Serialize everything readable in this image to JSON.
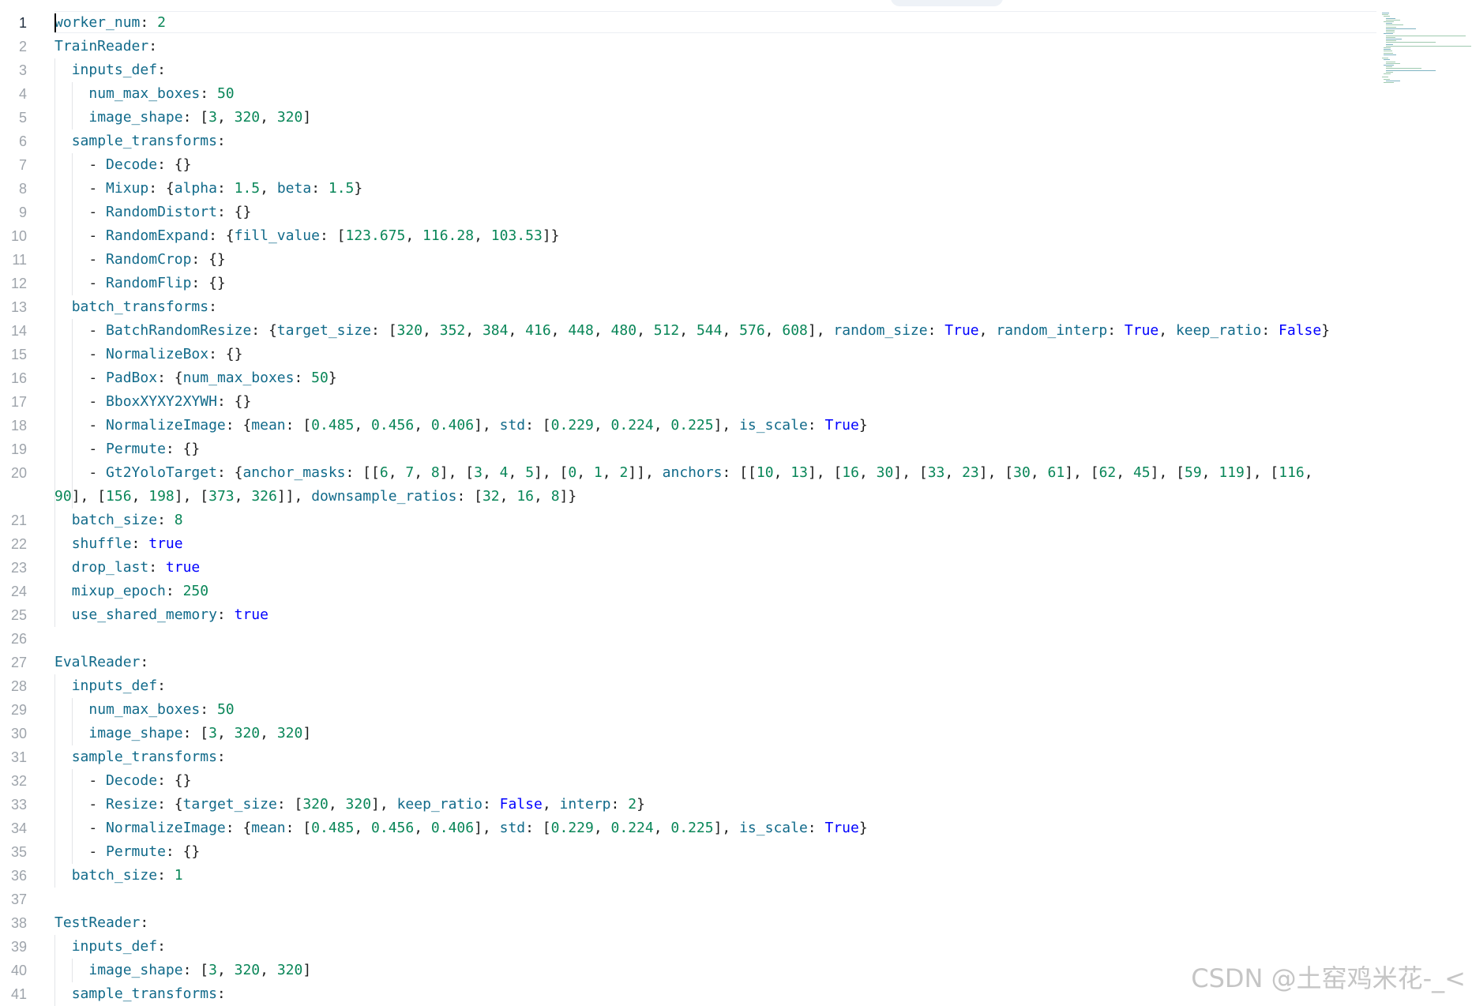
{
  "editor": {
    "active_line": 1,
    "lines": [
      {
        "num": 1,
        "text": "worker_num: 2"
      },
      {
        "num": 2,
        "text": "TrainReader:"
      },
      {
        "num": 3,
        "text": "  inputs_def:"
      },
      {
        "num": 4,
        "text": "    num_max_boxes: 50"
      },
      {
        "num": 5,
        "text": "    image_shape: [3, 320, 320]"
      },
      {
        "num": 6,
        "text": "  sample_transforms:"
      },
      {
        "num": 7,
        "text": "    - Decode: {}"
      },
      {
        "num": 8,
        "text": "    - Mixup: {alpha: 1.5, beta: 1.5}"
      },
      {
        "num": 9,
        "text": "    - RandomDistort: {}"
      },
      {
        "num": 10,
        "text": "    - RandomExpand: {fill_value: [123.675, 116.28, 103.53]}"
      },
      {
        "num": 11,
        "text": "    - RandomCrop: {}"
      },
      {
        "num": 12,
        "text": "    - RandomFlip: {}"
      },
      {
        "num": 13,
        "text": "  batch_transforms:"
      },
      {
        "num": 14,
        "text": "    - BatchRandomResize: {target_size: [320, 352, 384, 416, 448, 480, 512, 544, 576, 608], random_size: True, random_interp: True, keep_ratio: False}"
      },
      {
        "num": 15,
        "text": "    - NormalizeBox: {}"
      },
      {
        "num": 16,
        "text": "    - PadBox: {num_max_boxes: 50}"
      },
      {
        "num": 17,
        "text": "    - BboxXYXY2XYWH: {}"
      },
      {
        "num": 18,
        "text": "    - NormalizeImage: {mean: [0.485, 0.456, 0.406], std: [0.229, 0.224, 0.225], is_scale: True}"
      },
      {
        "num": 19,
        "text": "    - Permute: {}"
      },
      {
        "num": 20,
        "text": "    - Gt2YoloTarget: {anchor_masks: [[6, 7, 8], [3, 4, 5], [0, 1, 2]], anchors: [[10, 13], [16, 30], [33, 23], [30, 61], [62, 45], [59, 119], [116, 90], [156, 198], [373, 326]], downsample_ratios: [32, 16, 8]}",
        "wrapped": true
      },
      {
        "num": 21,
        "text": "  batch_size: 8"
      },
      {
        "num": 22,
        "text": "  shuffle: true"
      },
      {
        "num": 23,
        "text": "  drop_last: true"
      },
      {
        "num": 24,
        "text": "  mixup_epoch: 250"
      },
      {
        "num": 25,
        "text": "  use_shared_memory: true"
      },
      {
        "num": 26,
        "text": ""
      },
      {
        "num": 27,
        "text": "EvalReader:"
      },
      {
        "num": 28,
        "text": "  inputs_def:"
      },
      {
        "num": 29,
        "text": "    num_max_boxes: 50"
      },
      {
        "num": 30,
        "text": "    image_shape: [3, 320, 320]"
      },
      {
        "num": 31,
        "text": "  sample_transforms:"
      },
      {
        "num": 32,
        "text": "    - Decode: {}"
      },
      {
        "num": 33,
        "text": "    - Resize: {target_size: [320, 320], keep_ratio: False, interp: 2}"
      },
      {
        "num": 34,
        "text": "    - NormalizeImage: {mean: [0.485, 0.456, 0.406], std: [0.229, 0.224, 0.225], is_scale: True}"
      },
      {
        "num": 35,
        "text": "    - Permute: {}"
      },
      {
        "num": 36,
        "text": "  batch_size: 1"
      },
      {
        "num": 37,
        "text": ""
      },
      {
        "num": 38,
        "text": "TestReader:"
      },
      {
        "num": 39,
        "text": "  inputs_def:"
      },
      {
        "num": 40,
        "text": "    image_shape: [3, 320, 320]"
      },
      {
        "num": 41,
        "text": "  sample_transforms:"
      }
    ]
  },
  "colors": {
    "key": "#116a8a",
    "number": "#098658",
    "boolean": "#0000ff",
    "line_number": "#9ea4ab",
    "active_line_number": "#1f2d3d"
  },
  "watermark": "CSDN @土窑鸡米花-_<"
}
